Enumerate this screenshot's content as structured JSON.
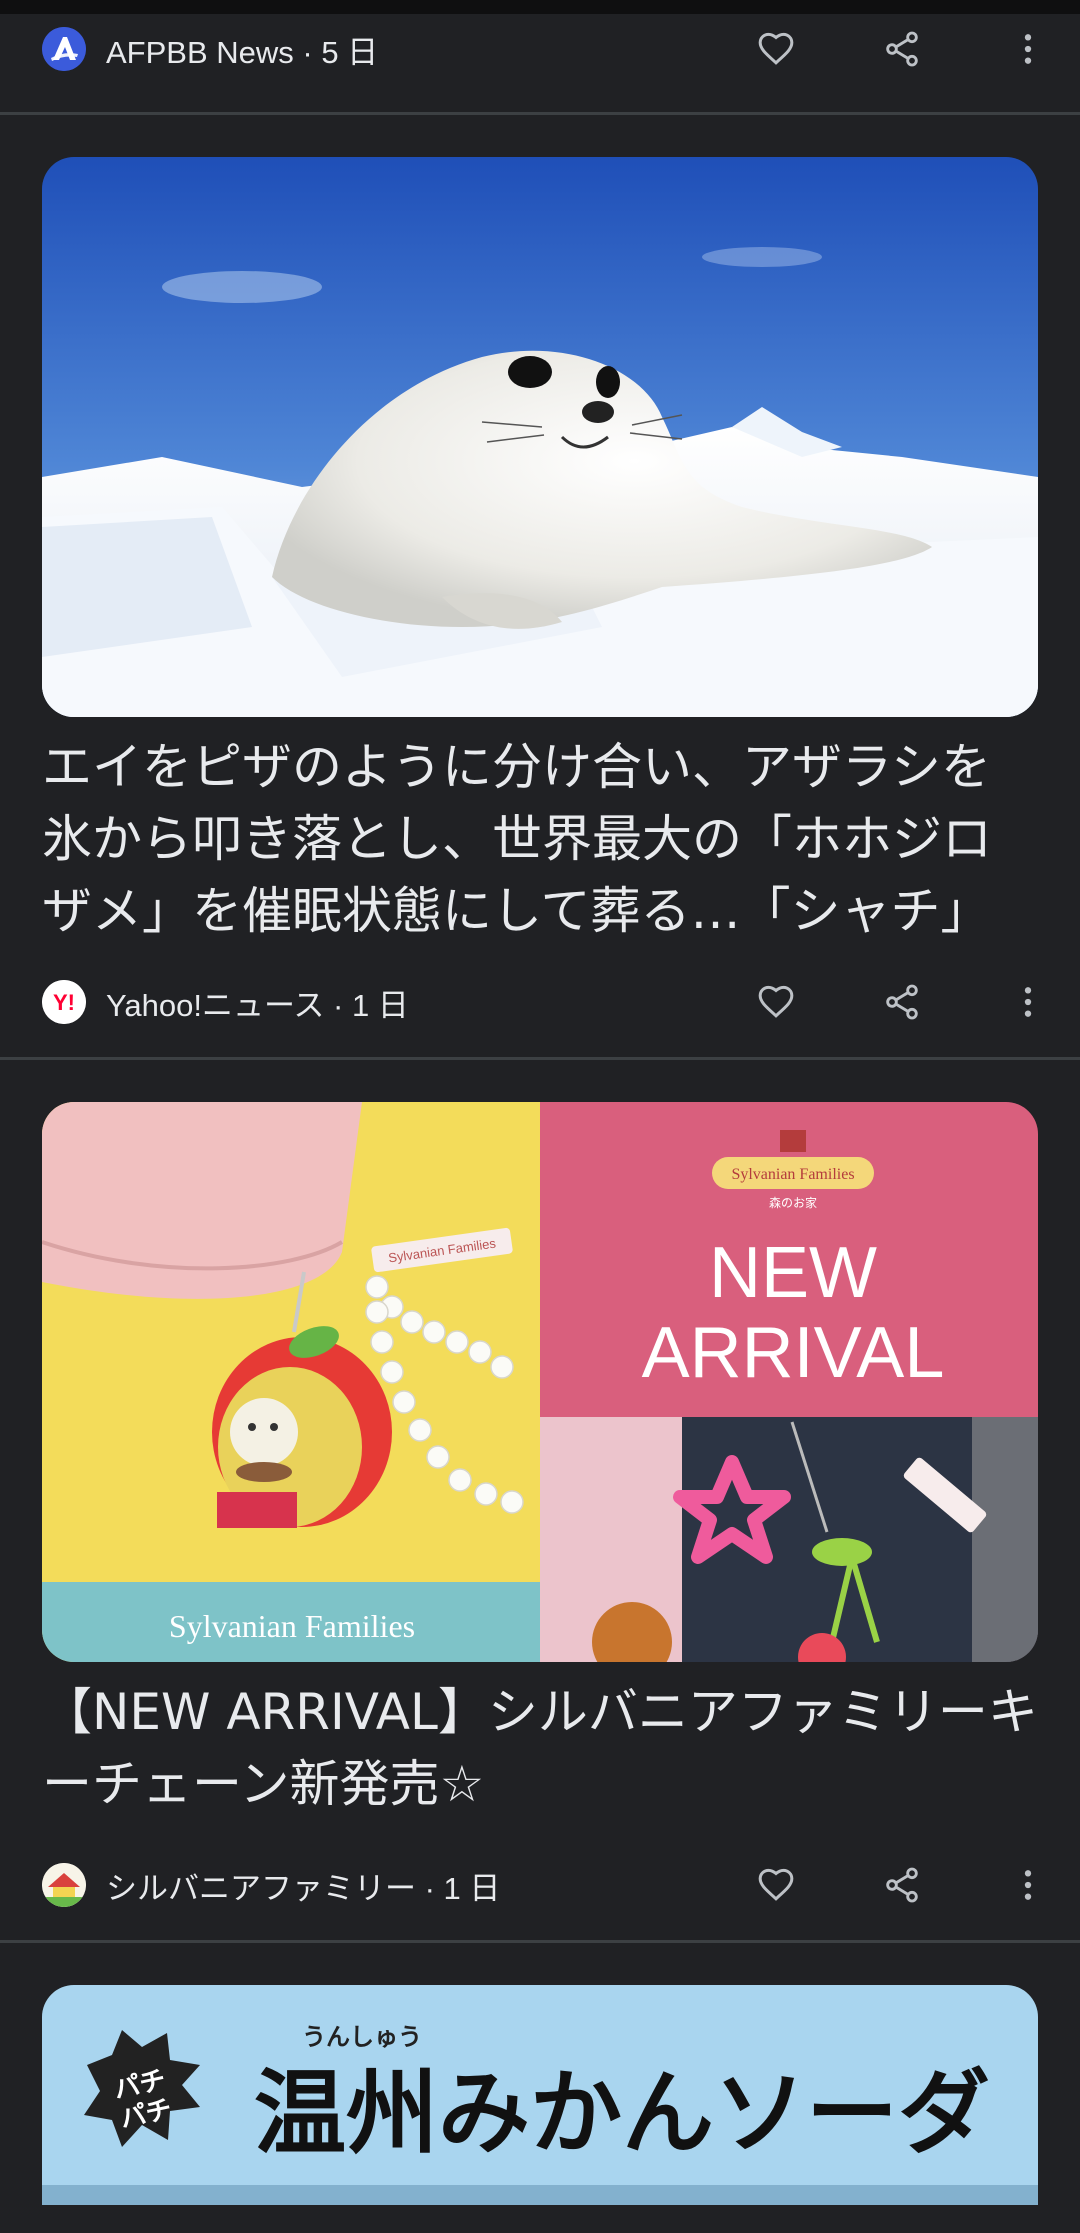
{
  "cards": [
    {
      "source": "AFPBB News",
      "age_sep": " · ",
      "age": "5 日",
      "meta_text": "AFPBB News · 5 日"
    },
    {
      "image_desc": "seal-on-ice",
      "headline": "エイをピザのように分け合い、アザラシを氷から叩き落とし、世界最大の「ホホジロザメ」を催眠状態にして葬る…「シャチ」",
      "meta_text": "Yahoo!ニュース · 1 日"
    },
    {
      "image_texts": {
        "brand_small": "Sylvanian Families",
        "brand_sub": "森のお家",
        "new_arrival_line1": "NEW",
        "new_arrival_line2": "ARRIVAL",
        "tag_text": "Sylvanian Families",
        "footer_brand": "Sylvanian Families"
      },
      "headline": "【NEW ARRIVAL】シルバニアファミリーキーチェーン新発売☆",
      "meta_text": "シルバニアファミリー · 1 日"
    },
    {
      "image_texts": {
        "ruby": "うんしゅう",
        "burst": "パチ\nパチ",
        "title": "温州みかんソーダ"
      }
    }
  ],
  "colors": {
    "background": "#202124",
    "divider": "#3c4043",
    "text": "#e8eaed",
    "icon": "#bdc1c6",
    "afp_blue": "#3b5bdb",
    "yahoo_red": "#ff0033"
  },
  "icons": {
    "like": "heart-outline-icon",
    "share": "share-icon",
    "more": "more-vert-icon"
  }
}
